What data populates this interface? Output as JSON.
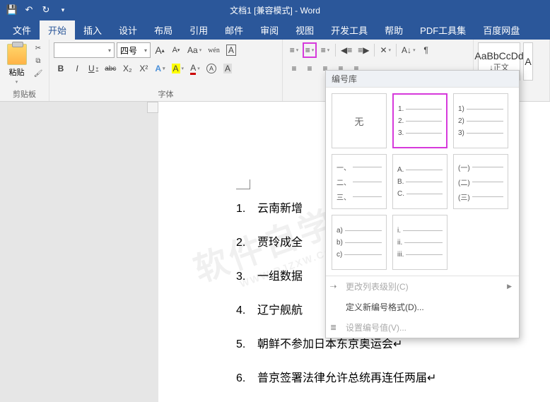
{
  "title": "文档1 [兼容模式] - Word",
  "tabs": [
    "文件",
    "开始",
    "插入",
    "设计",
    "布局",
    "引用",
    "邮件",
    "审阅",
    "视图",
    "开发工具",
    "帮助",
    "PDF工具集",
    "百度网盘"
  ],
  "active_tab": 1,
  "clipboard": {
    "paste": "粘贴",
    "label": "剪贴板"
  },
  "font": {
    "name": "",
    "size": "四号",
    "label": "字体",
    "buttons": {
      "incr": "A",
      "decr": "A",
      "clear": "Aa",
      "phonetic": "wén",
      "charborder": "A"
    },
    "row2": {
      "bold": "B",
      "italic": "I",
      "underline": "U",
      "strike": "abc",
      "sub": "X₂",
      "sup": "X²",
      "texteffect": "A",
      "highlight": "A",
      "fontcolor": "A",
      "charshade": "A"
    }
  },
  "styles": {
    "normal_sample": "AaBbCcDd",
    "normal_label": "↓正文"
  },
  "doc": {
    "items": [
      {
        "n": "1.",
        "t": "云南新增"
      },
      {
        "n": "2.",
        "t": "贾玲成全"
      },
      {
        "n": "3.",
        "t": "一组数据"
      },
      {
        "n": "4.",
        "t": "辽宁舰航"
      },
      {
        "n": "5.",
        "t": "朝鲜不参加日本东京奥运会↵"
      },
      {
        "n": "6.",
        "t": "普京签署法律允许总统再连任两届↵"
      }
    ]
  },
  "gallery": {
    "header": "编号库",
    "none": "无",
    "opts": {
      "arabic_dot": [
        "1.",
        "2.",
        "3."
      ],
      "arabic_paren": [
        "1)",
        "2)",
        "3)"
      ],
      "cjk_enum": [
        "一、",
        "二、",
        "三、"
      ],
      "upper_alpha": [
        "A.",
        "B.",
        "C."
      ],
      "cjk_paren": [
        "(一)",
        "(二)",
        "(三)"
      ],
      "lower_alpha_paren": [
        "a)",
        "b)",
        "c)"
      ],
      "roman_lower": [
        "i.",
        "ii.",
        "iii."
      ]
    },
    "footer": {
      "change_level": "更改列表级别(C)",
      "define": "定义新编号格式(D)...",
      "set_value": "设置编号值(V)..."
    }
  },
  "watermark": {
    "main": "软件自学网",
    "sub": "WWW.RJZXW.COM"
  }
}
